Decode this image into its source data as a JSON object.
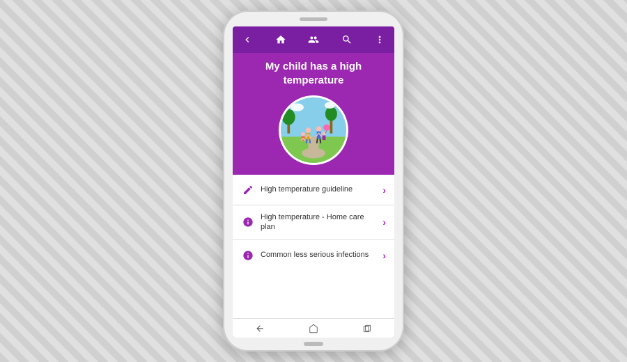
{
  "phone": {
    "nav": {
      "back_label": "‹",
      "home_label": "⌂",
      "people_label": "👥",
      "search_label": "🔍",
      "more_label": "···"
    },
    "hero": {
      "title": "My child has a high temperature"
    },
    "menu_items": [
      {
        "icon_type": "pencil",
        "label": "High temperature guideline",
        "has_chevron": true
      },
      {
        "icon_type": "info",
        "label": "High temperature - Home care plan",
        "has_chevron": true
      },
      {
        "icon_type": "info",
        "label": "Common less serious infections",
        "has_chevron": true
      }
    ],
    "bottom_nav": {
      "back": "back",
      "home": "home",
      "recent": "recent"
    },
    "colors": {
      "primary": "#9c27b0",
      "dark": "#7b1fa2",
      "accent": "#ffffff"
    }
  }
}
